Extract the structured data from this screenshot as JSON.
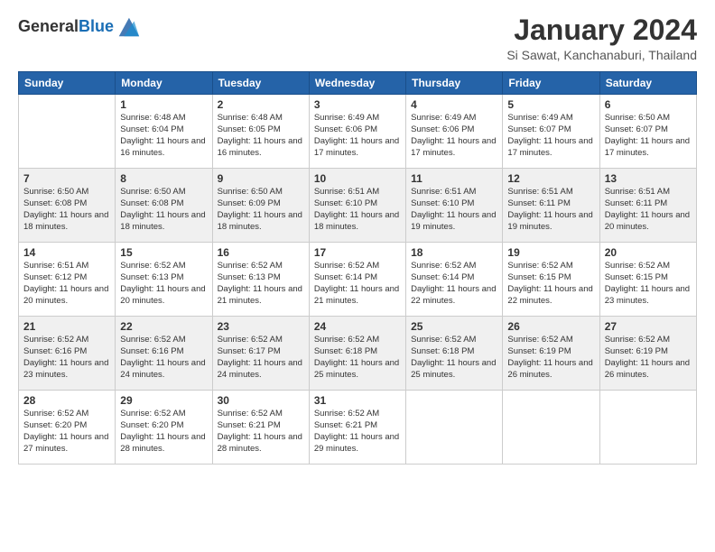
{
  "header": {
    "logo_line1": "General",
    "logo_line2": "Blue",
    "month": "January 2024",
    "location": "Si Sawat, Kanchanaburi, Thailand"
  },
  "days_of_week": [
    "Sunday",
    "Monday",
    "Tuesday",
    "Wednesday",
    "Thursday",
    "Friday",
    "Saturday"
  ],
  "weeks": [
    [
      {
        "day": "",
        "sunrise": "",
        "sunset": "",
        "daylight": ""
      },
      {
        "day": "1",
        "sunrise": "Sunrise: 6:48 AM",
        "sunset": "Sunset: 6:04 PM",
        "daylight": "Daylight: 11 hours and 16 minutes."
      },
      {
        "day": "2",
        "sunrise": "Sunrise: 6:48 AM",
        "sunset": "Sunset: 6:05 PM",
        "daylight": "Daylight: 11 hours and 16 minutes."
      },
      {
        "day": "3",
        "sunrise": "Sunrise: 6:49 AM",
        "sunset": "Sunset: 6:06 PM",
        "daylight": "Daylight: 11 hours and 17 minutes."
      },
      {
        "day": "4",
        "sunrise": "Sunrise: 6:49 AM",
        "sunset": "Sunset: 6:06 PM",
        "daylight": "Daylight: 11 hours and 17 minutes."
      },
      {
        "day": "5",
        "sunrise": "Sunrise: 6:49 AM",
        "sunset": "Sunset: 6:07 PM",
        "daylight": "Daylight: 11 hours and 17 minutes."
      },
      {
        "day": "6",
        "sunrise": "Sunrise: 6:50 AM",
        "sunset": "Sunset: 6:07 PM",
        "daylight": "Daylight: 11 hours and 17 minutes."
      }
    ],
    [
      {
        "day": "7",
        "sunrise": "Sunrise: 6:50 AM",
        "sunset": "Sunset: 6:08 PM",
        "daylight": "Daylight: 11 hours and 18 minutes."
      },
      {
        "day": "8",
        "sunrise": "Sunrise: 6:50 AM",
        "sunset": "Sunset: 6:08 PM",
        "daylight": "Daylight: 11 hours and 18 minutes."
      },
      {
        "day": "9",
        "sunrise": "Sunrise: 6:50 AM",
        "sunset": "Sunset: 6:09 PM",
        "daylight": "Daylight: 11 hours and 18 minutes."
      },
      {
        "day": "10",
        "sunrise": "Sunrise: 6:51 AM",
        "sunset": "Sunset: 6:10 PM",
        "daylight": "Daylight: 11 hours and 18 minutes."
      },
      {
        "day": "11",
        "sunrise": "Sunrise: 6:51 AM",
        "sunset": "Sunset: 6:10 PM",
        "daylight": "Daylight: 11 hours and 19 minutes."
      },
      {
        "day": "12",
        "sunrise": "Sunrise: 6:51 AM",
        "sunset": "Sunset: 6:11 PM",
        "daylight": "Daylight: 11 hours and 19 minutes."
      },
      {
        "day": "13",
        "sunrise": "Sunrise: 6:51 AM",
        "sunset": "Sunset: 6:11 PM",
        "daylight": "Daylight: 11 hours and 20 minutes."
      }
    ],
    [
      {
        "day": "14",
        "sunrise": "Sunrise: 6:51 AM",
        "sunset": "Sunset: 6:12 PM",
        "daylight": "Daylight: 11 hours and 20 minutes."
      },
      {
        "day": "15",
        "sunrise": "Sunrise: 6:52 AM",
        "sunset": "Sunset: 6:13 PM",
        "daylight": "Daylight: 11 hours and 20 minutes."
      },
      {
        "day": "16",
        "sunrise": "Sunrise: 6:52 AM",
        "sunset": "Sunset: 6:13 PM",
        "daylight": "Daylight: 11 hours and 21 minutes."
      },
      {
        "day": "17",
        "sunrise": "Sunrise: 6:52 AM",
        "sunset": "Sunset: 6:14 PM",
        "daylight": "Daylight: 11 hours and 21 minutes."
      },
      {
        "day": "18",
        "sunrise": "Sunrise: 6:52 AM",
        "sunset": "Sunset: 6:14 PM",
        "daylight": "Daylight: 11 hours and 22 minutes."
      },
      {
        "day": "19",
        "sunrise": "Sunrise: 6:52 AM",
        "sunset": "Sunset: 6:15 PM",
        "daylight": "Daylight: 11 hours and 22 minutes."
      },
      {
        "day": "20",
        "sunrise": "Sunrise: 6:52 AM",
        "sunset": "Sunset: 6:15 PM",
        "daylight": "Daylight: 11 hours and 23 minutes."
      }
    ],
    [
      {
        "day": "21",
        "sunrise": "Sunrise: 6:52 AM",
        "sunset": "Sunset: 6:16 PM",
        "daylight": "Daylight: 11 hours and 23 minutes."
      },
      {
        "day": "22",
        "sunrise": "Sunrise: 6:52 AM",
        "sunset": "Sunset: 6:16 PM",
        "daylight": "Daylight: 11 hours and 24 minutes."
      },
      {
        "day": "23",
        "sunrise": "Sunrise: 6:52 AM",
        "sunset": "Sunset: 6:17 PM",
        "daylight": "Daylight: 11 hours and 24 minutes."
      },
      {
        "day": "24",
        "sunrise": "Sunrise: 6:52 AM",
        "sunset": "Sunset: 6:18 PM",
        "daylight": "Daylight: 11 hours and 25 minutes."
      },
      {
        "day": "25",
        "sunrise": "Sunrise: 6:52 AM",
        "sunset": "Sunset: 6:18 PM",
        "daylight": "Daylight: 11 hours and 25 minutes."
      },
      {
        "day": "26",
        "sunrise": "Sunrise: 6:52 AM",
        "sunset": "Sunset: 6:19 PM",
        "daylight": "Daylight: 11 hours and 26 minutes."
      },
      {
        "day": "27",
        "sunrise": "Sunrise: 6:52 AM",
        "sunset": "Sunset: 6:19 PM",
        "daylight": "Daylight: 11 hours and 26 minutes."
      }
    ],
    [
      {
        "day": "28",
        "sunrise": "Sunrise: 6:52 AM",
        "sunset": "Sunset: 6:20 PM",
        "daylight": "Daylight: 11 hours and 27 minutes."
      },
      {
        "day": "29",
        "sunrise": "Sunrise: 6:52 AM",
        "sunset": "Sunset: 6:20 PM",
        "daylight": "Daylight: 11 hours and 28 minutes."
      },
      {
        "day": "30",
        "sunrise": "Sunrise: 6:52 AM",
        "sunset": "Sunset: 6:21 PM",
        "daylight": "Daylight: 11 hours and 28 minutes."
      },
      {
        "day": "31",
        "sunrise": "Sunrise: 6:52 AM",
        "sunset": "Sunset: 6:21 PM",
        "daylight": "Daylight: 11 hours and 29 minutes."
      },
      {
        "day": "",
        "sunrise": "",
        "sunset": "",
        "daylight": ""
      },
      {
        "day": "",
        "sunrise": "",
        "sunset": "",
        "daylight": ""
      },
      {
        "day": "",
        "sunrise": "",
        "sunset": "",
        "daylight": ""
      }
    ]
  ]
}
